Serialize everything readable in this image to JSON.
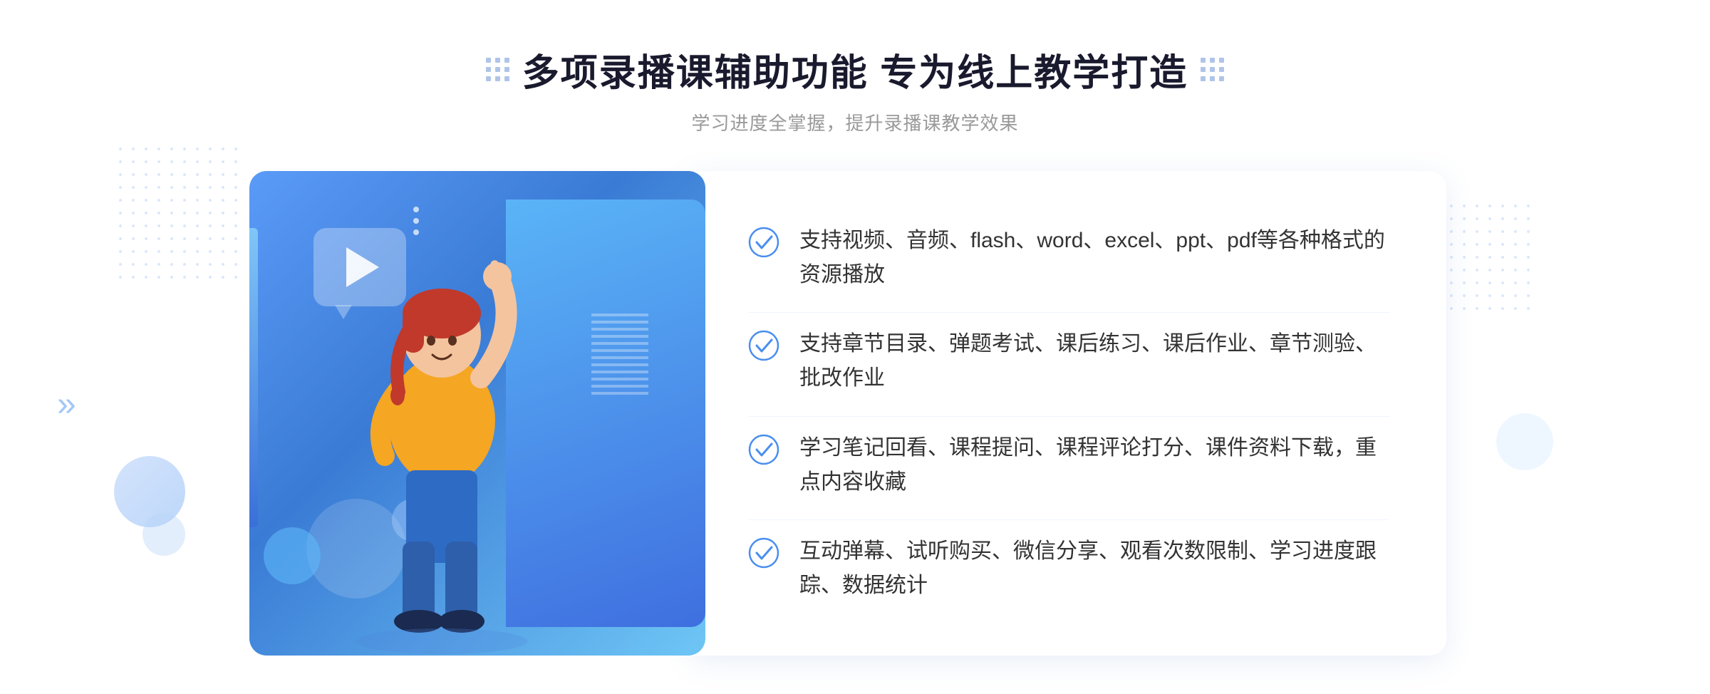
{
  "header": {
    "title": "多项录播课辅助功能 专为线上教学打造",
    "subtitle": "学习进度全掌握，提升录播课教学效果"
  },
  "features": [
    {
      "id": "feature-1",
      "text": "支持视频、音频、flash、word、excel、ppt、pdf等各种格式的资源播放"
    },
    {
      "id": "feature-2",
      "text": "支持章节目录、弹题考试、课后练习、课后作业、章节测验、批改作业"
    },
    {
      "id": "feature-3",
      "text": "学习笔记回看、课程提问、课程评论打分、课件资料下载，重点内容收藏"
    },
    {
      "id": "feature-4",
      "text": "互动弹幕、试听购买、微信分享、观看次数限制、学习进度跟踪、数据统计"
    }
  ],
  "icons": {
    "check": "check-circle-icon",
    "play": "play-icon",
    "chevron": "chevron-icon"
  },
  "colors": {
    "primary": "#4a8ef0",
    "titleColor": "#1a1a2e",
    "subtitleColor": "#999999",
    "textColor": "#333333",
    "cardGradientStart": "#5b9bf8",
    "cardGradientEnd": "#3a7bd5"
  }
}
